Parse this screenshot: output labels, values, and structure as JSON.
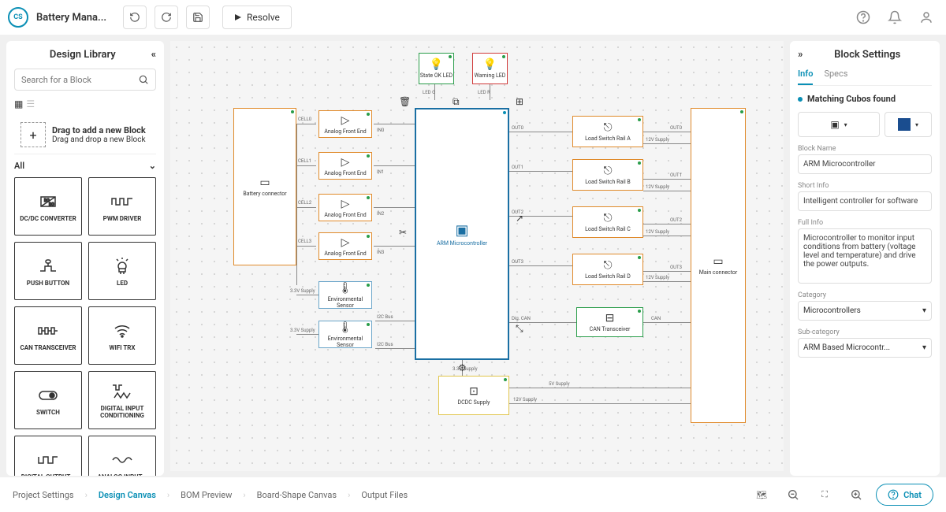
{
  "header": {
    "project": "Battery Mana...",
    "resolve": "Resolve"
  },
  "sidebar": {
    "title": "Design Library",
    "search_placeholder": "Search for a Block",
    "drag_title": "Drag to add a new Block",
    "drag_sub": "Drag and drop a new Block",
    "filter": "All",
    "blocks": [
      {
        "name": "DC/DC CONVERTER"
      },
      {
        "name": "PWM DRIVER"
      },
      {
        "name": "PUSH BUTTON"
      },
      {
        "name": "LED"
      },
      {
        "name": "CAN TRANSCEIVER"
      },
      {
        "name": "WIFI TRX"
      },
      {
        "name": "SWITCH"
      },
      {
        "name": "DIGITAL INPUT CONDITIONING"
      },
      {
        "name": "DIGITAL OUTPUT..."
      },
      {
        "name": "ANALOG INPUT..."
      }
    ]
  },
  "canvas": {
    "nodes": {
      "battery": {
        "label": "Battery connector",
        "color": "#e08a2a"
      },
      "afe": {
        "label": "Analog Front End",
        "color": "#e08a2a"
      },
      "cells": [
        "CELL0",
        "CELL1",
        "CELL2",
        "CELL3"
      ],
      "ins": [
        "IN0",
        "IN1",
        "IN2",
        "IN3"
      ],
      "mcu": {
        "label": "ARM Microcontroller",
        "color": "#1a6fa3"
      },
      "env": {
        "label": "Environmental Sensor",
        "color": "#6aa5c9"
      },
      "state_led": {
        "label": "State OK LED",
        "color": "#2a9d4a"
      },
      "warn_led": {
        "label": "Warning LED",
        "color": "#d03a3a"
      },
      "load": [
        "Load Switch Rail A",
        "Load Switch Rail B",
        "Load Switch Rail C",
        "Load Switch Rail D"
      ],
      "outs": [
        "OUT0",
        "OUT1",
        "OUT2",
        "OUT3"
      ],
      "supply": [
        "12V Supply",
        "12V Supply",
        "12V Supply",
        "12V Supply"
      ],
      "main_conn": {
        "label": "Main connector",
        "color": "#e08a2a"
      },
      "can": {
        "label": "CAN Transceiver",
        "color": "#2a9d4a"
      },
      "dcdc": {
        "label": "DCDC Supply",
        "color": "#e0c54a"
      },
      "led_ports": [
        "LED G",
        "LED R"
      ],
      "sensor_supply": "3.3V Supply",
      "sensor_bus": "I2C Bus",
      "mcu_can": "Dig. CAN",
      "can_port": "CAN",
      "sup5": "5V Supply",
      "sup12": "12V Supply",
      "sup33": "3.3V Supply"
    }
  },
  "rightpanel": {
    "title": "Block Settings",
    "tabs": [
      "Info",
      "Specs"
    ],
    "matching": "Matching Cubos found",
    "fields": {
      "name_lbl": "Block Name",
      "name": "ARM Microcontroller",
      "short_lbl": "Short Info",
      "short": "Intelligent controller for software",
      "full_lbl": "Full Info",
      "full": "Microcontroller to monitor input conditions from battery (voltage level and temperature) and drive the power outputs.",
      "cat_lbl": "Category",
      "cat": "Microcontrollers",
      "subcat_lbl": "Sub-category",
      "subcat": "ARM Based Microcontr..."
    }
  },
  "bottombar": {
    "crumbs": [
      "Project Settings",
      "Design Canvas",
      "BOM Preview",
      "Board-Shape Canvas",
      "Output Files"
    ],
    "chat": "Chat"
  }
}
